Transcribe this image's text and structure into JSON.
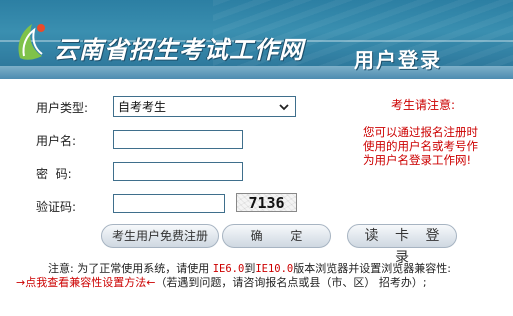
{
  "header": {
    "site_title": "云南省招生考试工作网",
    "login_title": "用户登录"
  },
  "form": {
    "user_type_label": "用户类型:",
    "user_type_value": "自考考生",
    "username_label": "用户名:",
    "username_value": "",
    "password_label": "密  码:",
    "password_value": "",
    "captcha_label": "验证码:",
    "captcha_value": "",
    "captcha_text": "7136"
  },
  "buttons": {
    "register": "考生用户免费注册",
    "confirm": "确 定",
    "card_login": "读 卡 登 录"
  },
  "notice": {
    "title": "考生请注意:",
    "body": "您可以通过报名注册时使用的用户名或考号作为用户名登录工作网!"
  },
  "footer": {
    "line1_prefix": "注意: 为了正常使用系统，请使用 ",
    "ie_min": "IE6.0",
    "to": "到",
    "ie_max": "IE10.0",
    "line1_suffix": "版本浏览器并设置浏览器兼容性:",
    "compat_link": "→点我查看兼容性设置方法←",
    "line2_suffix": "（若遇到问题，请咨询报名点或县（市、区） 招考办）;"
  },
  "colors": {
    "banner": "#2c7fa3",
    "notice_red": "#cc0000",
    "input_border": "#3f6f8c"
  },
  "icons": {
    "logo": "leaf-logo-icon",
    "select_arrow": "chevron-down-icon"
  }
}
